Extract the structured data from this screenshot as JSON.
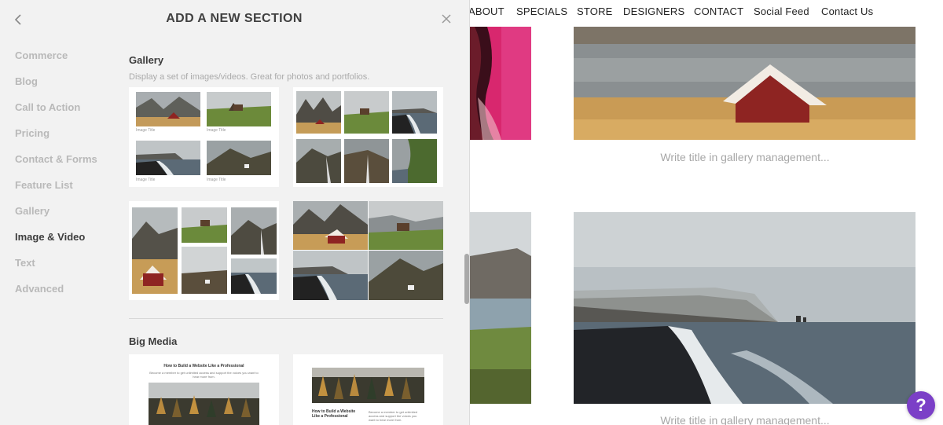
{
  "panel": {
    "title": "ADD A NEW SECTION",
    "categories": [
      {
        "label": "Commerce"
      },
      {
        "label": "Blog"
      },
      {
        "label": "Call to Action"
      },
      {
        "label": "Pricing"
      },
      {
        "label": "Contact & Forms"
      },
      {
        "label": "Feature List"
      },
      {
        "label": "Gallery"
      },
      {
        "label": "Image & Video",
        "active": true
      },
      {
        "label": "Text"
      },
      {
        "label": "Advanced"
      }
    ],
    "gallery_section": {
      "title": "Gallery",
      "description": "Display a set of images/videos. Great for photos and portfolios.",
      "thumb_caption": "Image Title"
    },
    "big_media_section": {
      "title": "Big Media",
      "card1_heading": "How to Build a Website Like a Professional",
      "card1_text": "Become a member to get unlimited access and support the voices you want to hear more from.",
      "card2_heading": "How to Build a Website Like a Professional",
      "card2_text": "Become a member to get unlimited access and support the voices you want to hear more from."
    }
  },
  "site": {
    "nav": [
      "ABOUT",
      "SPECIALS",
      "STORE",
      "DESIGNERS",
      "CONTACT",
      "Social Feed",
      "Contact Us"
    ],
    "caption_1": "Write title in gallery management...",
    "caption_2": "Write title in gallery management..."
  },
  "help_button": {
    "label": "?"
  },
  "colors": {
    "panel_bg": "#f2f2f2",
    "help_accent": "#7b3fc7",
    "active_category": "#3d3d3d",
    "inactive_category": "#b9b9b9"
  },
  "icons": [
    "chevron-left-icon",
    "close-icon",
    "help-icon"
  ]
}
